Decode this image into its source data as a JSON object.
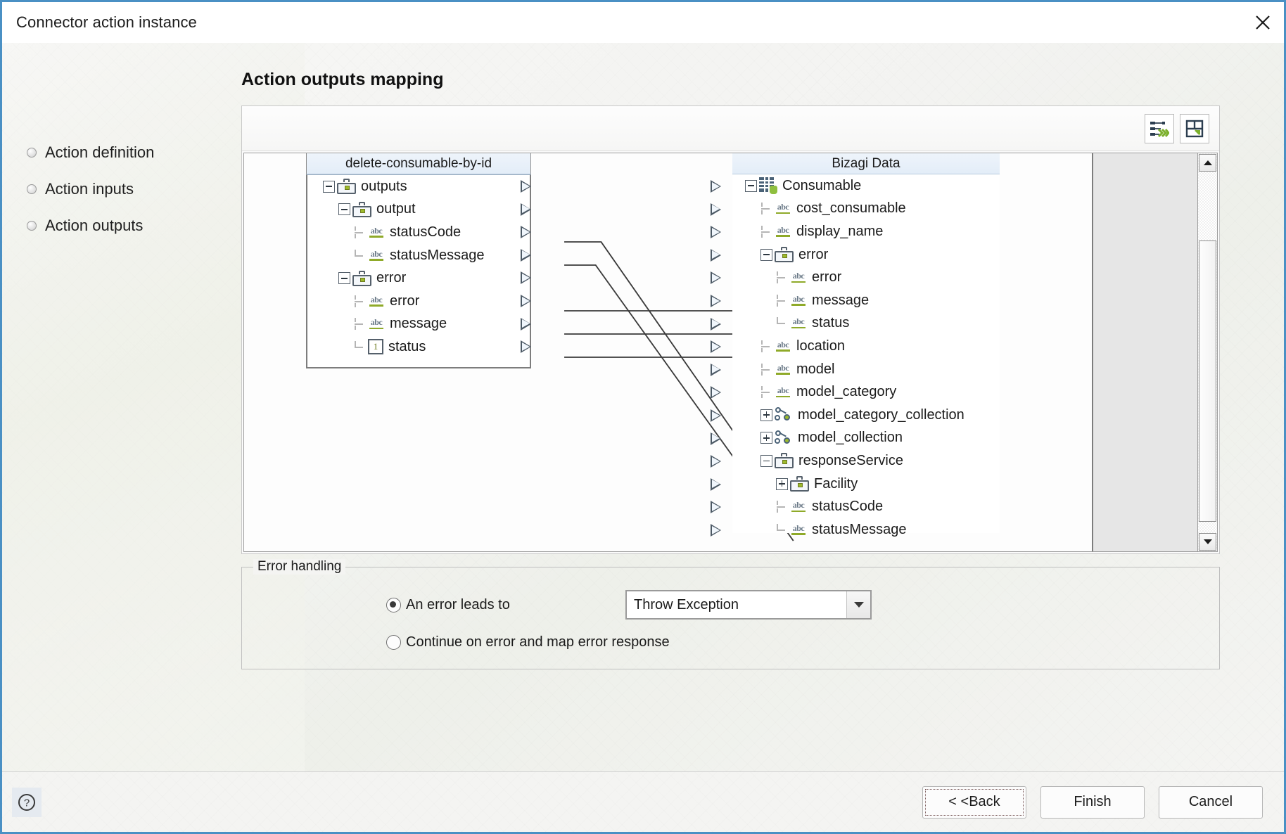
{
  "window": {
    "title": "Connector action instance",
    "close_icon": "close-icon"
  },
  "sidebar": {
    "items": [
      {
        "label": "Action definition"
      },
      {
        "label": "Action inputs"
      },
      {
        "label": "Action outputs"
      }
    ]
  },
  "main": {
    "page_title": "Action outputs mapping",
    "toolbar": {
      "auto_map_label": "auto-map-icon",
      "layout_label": "save-layout-icon"
    },
    "mapper": {
      "left_panel_header": "delete-consumable-by-id",
      "right_panel_header": "Bizagi Data",
      "left_tree": [
        {
          "label": "outputs",
          "depth": 0,
          "icon": "case-icon",
          "expander": "minus",
          "arrow": true
        },
        {
          "label": "output",
          "depth": 1,
          "icon": "case-icon",
          "expander": "minus",
          "arrow": true
        },
        {
          "label": "statusCode",
          "depth": 2,
          "icon": "abc-icon",
          "expander": "stub",
          "arrow": true
        },
        {
          "label": "statusMessage",
          "depth": 2,
          "icon": "abc-icon",
          "expander": "stub-last",
          "arrow": true
        },
        {
          "label": "error",
          "depth": 1,
          "icon": "case-icon",
          "expander": "minus",
          "arrow": true
        },
        {
          "label": "error",
          "depth": 2,
          "icon": "abc-icon",
          "expander": "stub",
          "arrow": true
        },
        {
          "label": "message",
          "depth": 2,
          "icon": "abc-icon",
          "expander": "stub",
          "arrow": true
        },
        {
          "label": "status",
          "depth": 2,
          "icon": "number-icon",
          "expander": "stub-last",
          "arrow": true
        }
      ],
      "right_tree": [
        {
          "label": "Consumable",
          "depth": 0,
          "icon": "entity-icon",
          "expander": "minus",
          "arrow": true
        },
        {
          "label": "cost_consumable",
          "depth": 1,
          "icon": "abc-icon",
          "expander": "stub",
          "arrow": true
        },
        {
          "label": "display_name",
          "depth": 1,
          "icon": "abc-icon",
          "expander": "stub",
          "arrow": true
        },
        {
          "label": "error",
          "depth": 1,
          "icon": "case-icon",
          "expander": "minus",
          "arrow": true
        },
        {
          "label": "error",
          "depth": 2,
          "icon": "abc-icon",
          "expander": "stub",
          "arrow": true
        },
        {
          "label": "message",
          "depth": 2,
          "icon": "abc-icon",
          "expander": "stub",
          "arrow": true
        },
        {
          "label": "status",
          "depth": 2,
          "icon": "abc-icon",
          "expander": "stub-last",
          "arrow": true
        },
        {
          "label": "location",
          "depth": 1,
          "icon": "abc-icon",
          "expander": "stub",
          "arrow": true
        },
        {
          "label": "model",
          "depth": 1,
          "icon": "abc-icon",
          "expander": "stub",
          "arrow": true
        },
        {
          "label": "model_category",
          "depth": 1,
          "icon": "abc-icon",
          "expander": "stub",
          "arrow": true
        },
        {
          "label": "model_category_collection",
          "depth": 1,
          "icon": "collection-icon",
          "expander": "plus",
          "arrow": true
        },
        {
          "label": "model_collection",
          "depth": 1,
          "icon": "collection-icon",
          "expander": "plus",
          "arrow": true
        },
        {
          "label": "responseService",
          "depth": 1,
          "icon": "case-icon",
          "expander": "minus",
          "arrow": true
        },
        {
          "label": "Facility",
          "depth": 2,
          "icon": "case-icon",
          "expander": "plus",
          "arrow": true
        },
        {
          "label": "statusCode",
          "depth": 2,
          "icon": "abc-icon",
          "expander": "stub",
          "arrow": true
        },
        {
          "label": "statusMessage",
          "depth": 2,
          "icon": "abc-icon",
          "expander": "stub-last",
          "arrow": true
        }
      ],
      "mappings": [
        {
          "from": "error",
          "to": "error",
          "from_index": 5,
          "to_index": 4
        },
        {
          "from": "message",
          "to": "message",
          "from_index": 6,
          "to_index": 5
        },
        {
          "from": "status",
          "to": "status",
          "from_index": 7,
          "to_index": 6
        },
        {
          "from": "statusCode",
          "to": "statusCode",
          "from_index": 2,
          "to_index": 14
        },
        {
          "from": "statusMessage",
          "to": "statusMessage",
          "from_index": 3,
          "to_index": 15
        }
      ]
    },
    "error_handling": {
      "legend": "Error handling",
      "option_1_label": "An error leads to",
      "option_1_selected": true,
      "option_2_label": "Continue on error and map error response",
      "option_2_selected": false,
      "select_value": "Throw Exception"
    }
  },
  "footer": {
    "help_icon": "help-icon",
    "back_label": "< <Back",
    "finish_label": "Finish",
    "cancel_label": "Cancel"
  }
}
